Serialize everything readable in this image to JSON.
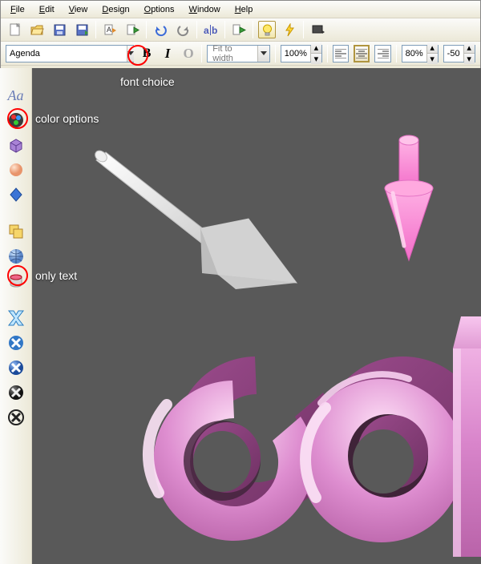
{
  "menubar": {
    "file": "File",
    "edit": "Edit",
    "view": "View",
    "design": "Design",
    "options": "Options",
    "window": "Window",
    "help": "Help"
  },
  "toolbar1": {
    "new": "new-icon",
    "open": "open-icon",
    "save": "save-icon",
    "saveas": "saveas-icon",
    "run": "run-icon",
    "play": "play-icon",
    "undo": "undo-icon",
    "redo": "redo-icon",
    "text": "text-icon",
    "runscript": "runscript-icon",
    "bulb": "bulb-icon",
    "bolt": "bolt-icon",
    "screen": "screen-icon"
  },
  "fontbar": {
    "font_value": "Agenda",
    "bold_label": "B",
    "italic_label": "I",
    "outline_label": "O",
    "fit_label": "Fit to width",
    "zoom1_value": "100%",
    "zoom2_value": "80%",
    "kern_value": "-50"
  },
  "annotations": {
    "font_choice": "font choice",
    "color_options": "color options",
    "only_text": "only text"
  },
  "sidebar_title": "Aa",
  "colors": {
    "canvas_bg": "#595959",
    "text_pink": "#d37ac8",
    "text_pink_light": "#f3c8ee",
    "arrow_white": "#ffffff",
    "arrow_pink": "#ff8ed9",
    "annotation_red": "#ff0000"
  }
}
